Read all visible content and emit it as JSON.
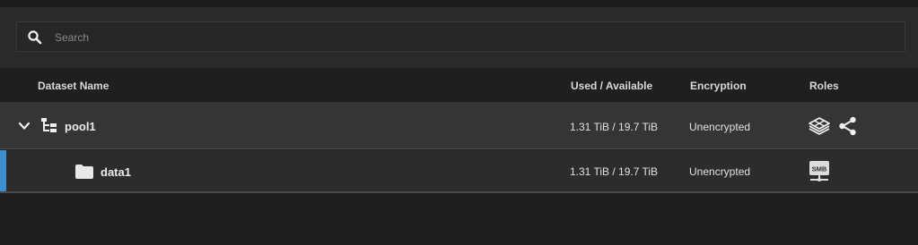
{
  "search": {
    "placeholder": "Search",
    "value": ""
  },
  "columns": {
    "name": "Dataset Name",
    "used": "Used / Available",
    "encryption": "Encryption",
    "roles": "Roles"
  },
  "rows": [
    {
      "name": "pool1",
      "used_available": "1.31 TiB / 19.7 TiB",
      "encryption": "Unencrypted",
      "expand_icon": "chevron-down-icon",
      "type_icon": "tree-structure-icon",
      "roles": [
        "storage-pool-icon",
        "share-icon"
      ]
    },
    {
      "name": "data1",
      "used_available": "1.31 TiB / 19.7 TiB",
      "encryption": "Unencrypted",
      "type_icon": "folder-icon",
      "roles": [
        "smb-share-icon"
      ],
      "role_label": "SMB"
    }
  ],
  "colors": {
    "accent": "#3b8fd1",
    "background": "#1f1f1f",
    "row_pool": "#353535",
    "row_data": "#2c2c2c"
  }
}
